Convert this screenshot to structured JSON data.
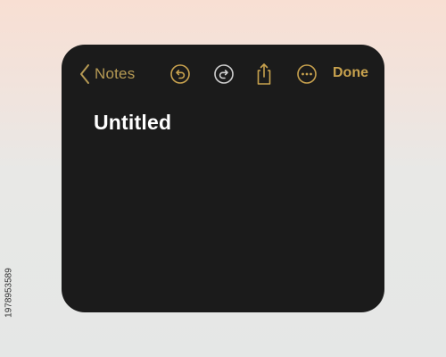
{
  "colors": {
    "accent": "#c8a24e",
    "window_background": "#1b1b1b",
    "title_text": "#ffffff"
  },
  "toolbar": {
    "back_label": "Notes",
    "back_icon": "chevron-left-icon",
    "tools": [
      {
        "name": "undo",
        "icon": "undo-icon"
      },
      {
        "name": "redo",
        "icon": "redo-icon"
      },
      {
        "name": "share",
        "icon": "share-icon"
      },
      {
        "name": "more",
        "icon": "more-icon"
      }
    ],
    "done_label": "Done"
  },
  "note": {
    "title": "Untitled"
  },
  "watermark": {
    "text": "1978953589"
  }
}
